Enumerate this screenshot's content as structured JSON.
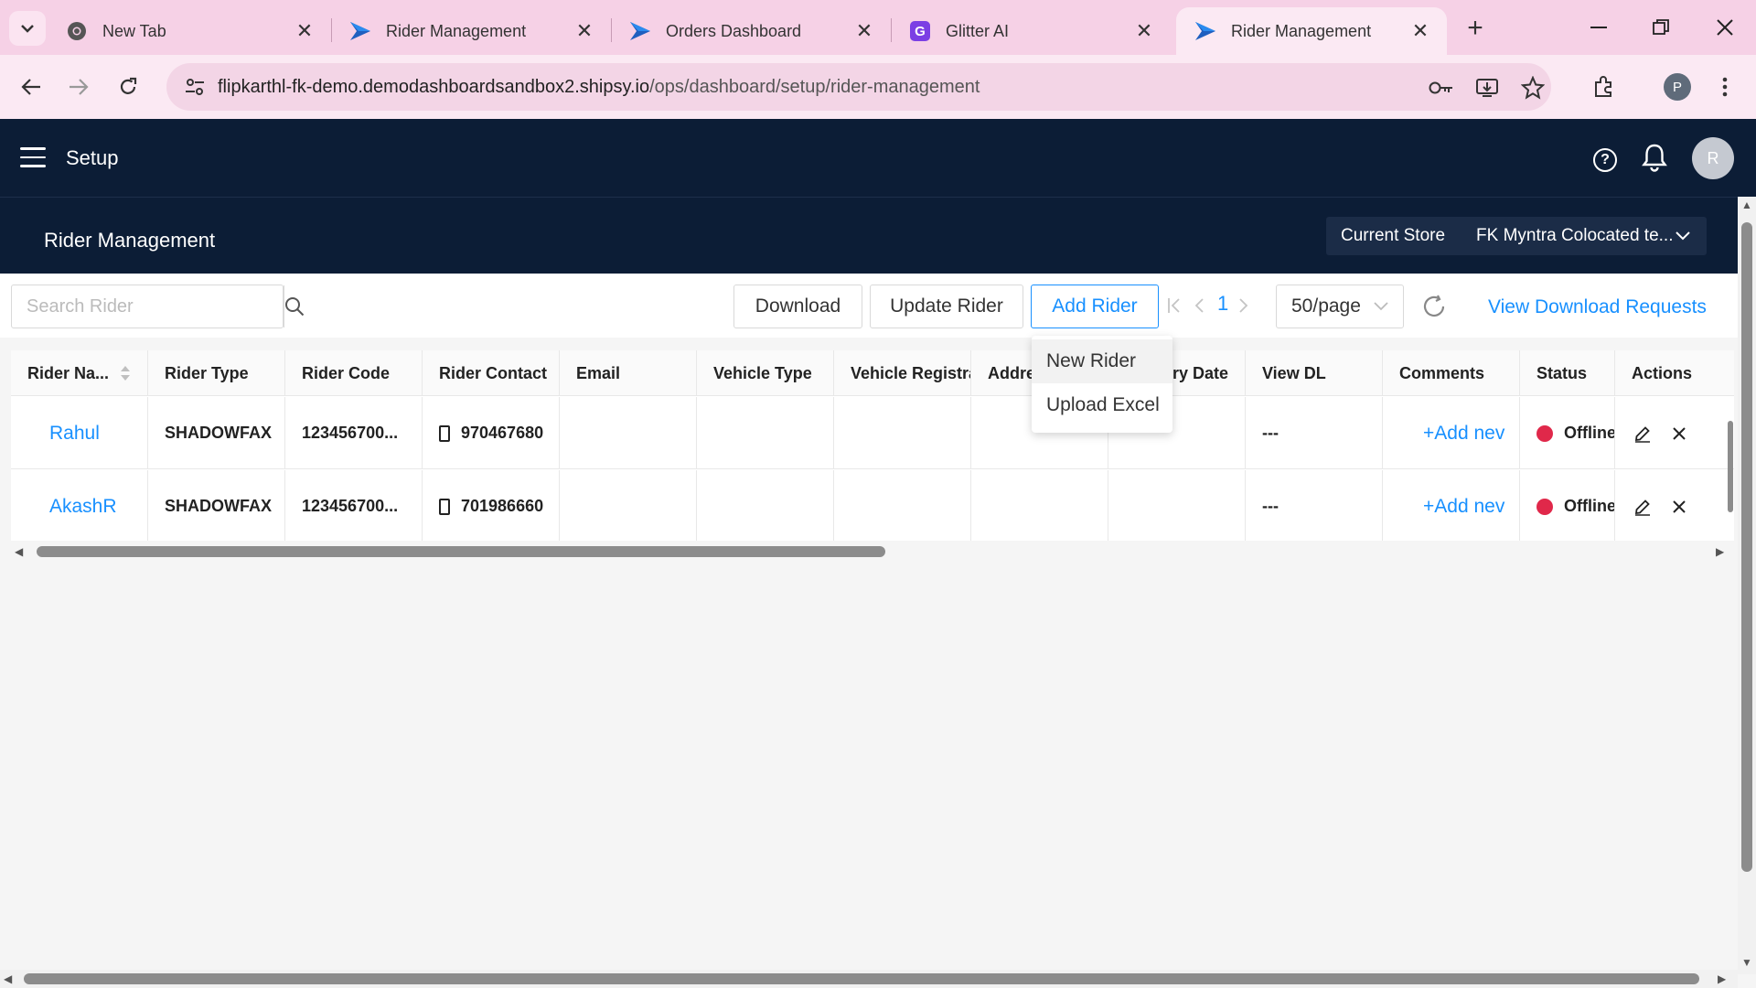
{
  "browser": {
    "tabs": [
      {
        "label": "New Tab",
        "icon": "chrome-icon"
      },
      {
        "label": "Rider Management",
        "icon": "shipsy-icon"
      },
      {
        "label": "Orders Dashboard",
        "icon": "shipsy-icon"
      },
      {
        "label": "Glitter AI",
        "icon": "glitter-icon"
      },
      {
        "label": "Rider Management",
        "icon": "shipsy-icon",
        "active": true
      }
    ],
    "url_domain": "flipkarthl-fk-demo.demodashboardsandbox2.shipsy.io",
    "url_path": "/ops/dashboard/setup/rider-management",
    "profile_initial": "P"
  },
  "app": {
    "title": "Setup",
    "avatar_initial": "R",
    "page_title": "Rider Management",
    "store_label": "Current Store",
    "store_value": "FK Myntra Colocated te..."
  },
  "toolbar": {
    "search_placeholder": "Search Rider",
    "download": "Download",
    "update_rider": "Update Rider",
    "add_rider": "Add Rider",
    "current_page": "1",
    "page_size": "50/page",
    "view_download_requests": "View Download Requests"
  },
  "add_menu": {
    "items": [
      "New Rider",
      "Upload Excel"
    ]
  },
  "table": {
    "columns": [
      "Rider Na...",
      "Rider Type",
      "Rider Code",
      "Rider Contact",
      "Email",
      "Vehicle Type",
      "Vehicle Registrat",
      "Addre",
      "piry Date",
      "View DL",
      "Comments",
      "Status",
      "Actions"
    ],
    "rows": [
      {
        "name": "Rahul",
        "type": "SHADOWFAX",
        "code": "123456700...",
        "contact": "970467680",
        "email": "",
        "vehicle_type": "",
        "vehicle_reg": "",
        "address": "",
        "expiry": "",
        "view_dl": "---",
        "comments": "+Add nev",
        "status": "Offline"
      },
      {
        "name": "AkashR",
        "type": "SHADOWFAX",
        "code": "123456700...",
        "contact": "701986660",
        "email": "",
        "vehicle_type": "",
        "vehicle_reg": "",
        "address": "",
        "expiry": "",
        "view_dl": "---",
        "comments": "+Add nev",
        "status": "Offline"
      }
    ]
  },
  "colors": {
    "header_bg": "#0c1d36",
    "accent": "#1890ff",
    "offline": "#e0284a",
    "tabbar": "#f6d1e6"
  }
}
